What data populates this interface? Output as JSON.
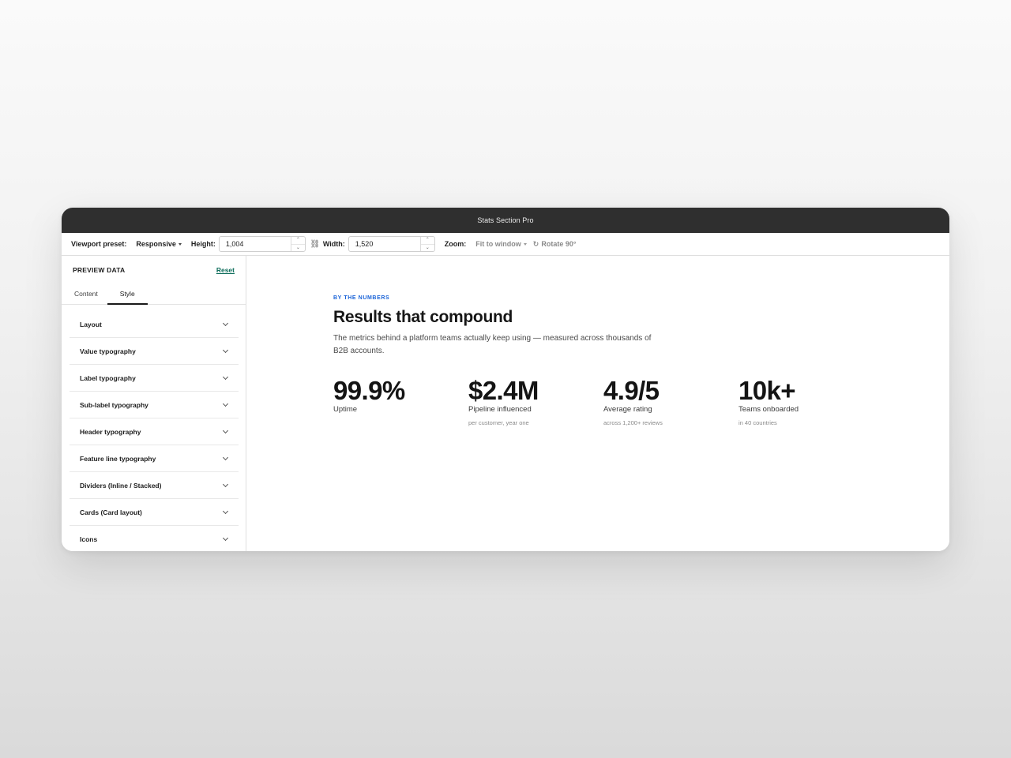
{
  "window": {
    "title": "Stats Section Pro"
  },
  "toolbar": {
    "viewport_label": "Viewport preset:",
    "viewport_value": "Responsive",
    "height_label": "Height:",
    "height_value": "1,004",
    "width_label": "Width:",
    "width_value": "1,520",
    "zoom_label": "Zoom:",
    "zoom_value": "Fit to window",
    "rotate_label": "Rotate 90°",
    "step_up": "⌃",
    "step_down": "⌄",
    "link_icon": "⛓",
    "rotate_icon": "↻"
  },
  "sidebar": {
    "title": "PREVIEW DATA",
    "reset": "Reset",
    "tabs": [
      {
        "label": "Content"
      },
      {
        "label": "Style"
      }
    ],
    "sections": [
      {
        "label": "Layout"
      },
      {
        "label": "Value typography"
      },
      {
        "label": "Label typography"
      },
      {
        "label": "Sub-label typography"
      },
      {
        "label": "Header typography"
      },
      {
        "label": "Feature line typography"
      },
      {
        "label": "Dividers (Inline / Stacked)"
      },
      {
        "label": "Cards (Card layout)"
      },
      {
        "label": "Icons"
      }
    ]
  },
  "preview": {
    "eyebrow": "BY THE NUMBERS",
    "headline": "Results that compound",
    "description": "The metrics behind a platform teams actually keep using — measured across thousands of B2B accounts.",
    "stats": [
      {
        "value": "99.9%",
        "label": "Uptime",
        "sub": ""
      },
      {
        "value": "$2.4M",
        "label": "Pipeline influenced",
        "sub": "per customer, year one"
      },
      {
        "value": "4.9/5",
        "label": "Average rating",
        "sub": "across 1,200+ reviews"
      },
      {
        "value": "10k+",
        "label": "Teams onboarded",
        "sub": "in 40 countries"
      }
    ]
  },
  "colors": {
    "titlebar": "#2f2f2f",
    "accent_link": "#0f6e5c",
    "eyebrow": "#1b64d8"
  }
}
